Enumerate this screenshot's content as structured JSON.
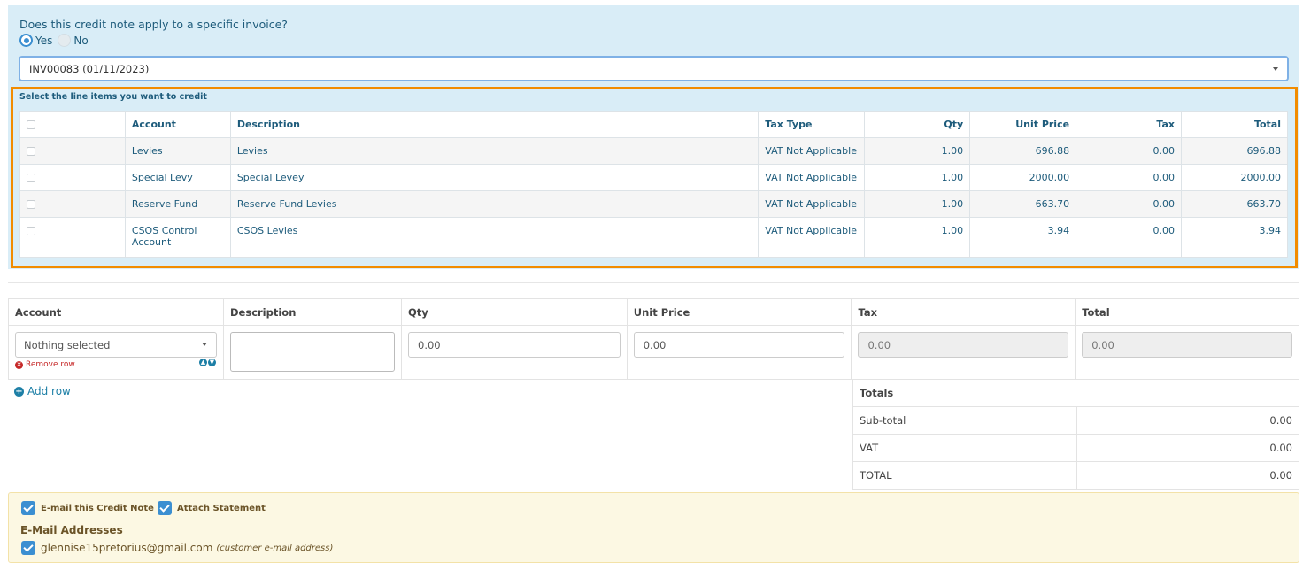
{
  "invoice_question": {
    "label": "Does this credit note apply to a specific invoice?",
    "options": [
      {
        "label": "Yes",
        "selected": true
      },
      {
        "label": "No",
        "selected": false
      }
    ],
    "selected_invoice": "INV00083 (01/11/2023)"
  },
  "line_items": {
    "instruction": "Select the line items you want to credit",
    "columns": [
      "Account",
      "Description",
      "Tax Type",
      "Qty",
      "Unit Price",
      "Tax",
      "Total"
    ],
    "rows": [
      {
        "account": "Levies",
        "description": "Levies",
        "tax_type": "VAT Not Applicable",
        "qty": "1.00",
        "unit_price": "696.88",
        "tax": "0.00",
        "total": "696.88"
      },
      {
        "account": "Special Levy",
        "description": "Special Levey",
        "tax_type": "VAT Not Applicable",
        "qty": "1.00",
        "unit_price": "2000.00",
        "tax": "0.00",
        "total": "2000.00"
      },
      {
        "account": "Reserve Fund",
        "description": "Reserve Fund Levies",
        "tax_type": "VAT Not Applicable",
        "qty": "1.00",
        "unit_price": "663.70",
        "tax": "0.00",
        "total": "663.70"
      },
      {
        "account": "CSOS Control Account",
        "description": "CSOS Levies",
        "tax_type": "VAT Not Applicable",
        "qty": "1.00",
        "unit_price": "3.94",
        "tax": "0.00",
        "total": "3.94"
      }
    ]
  },
  "entry": {
    "columns": [
      "Account",
      "Description",
      "Qty",
      "Unit Price",
      "Tax",
      "Total"
    ],
    "account_select": "Nothing selected",
    "remove_row": "Remove row",
    "qty": "0.00",
    "unit_price": "0.00",
    "tax": "0.00",
    "total": "0.00",
    "add_row": "Add row"
  },
  "totals": {
    "heading": "Totals",
    "sub_total_label": "Sub-total",
    "sub_total": "0.00",
    "vat_label": "VAT",
    "vat": "0.00",
    "total_label": "TOTAL",
    "total": "0.00"
  },
  "email": {
    "email_credit_note": "E-mail this Credit Note",
    "attach_statement": "Attach Statement",
    "addresses_title": "E-Mail Addresses",
    "address": "glennise15pretorius@gmail.com",
    "address_note": "(customer e-mail address)"
  },
  "colors": {
    "accent": "#3b8fd1",
    "highlight_border": "#f28c00",
    "panel": "#d9edf7",
    "text_blue": "#1d5b7b"
  }
}
